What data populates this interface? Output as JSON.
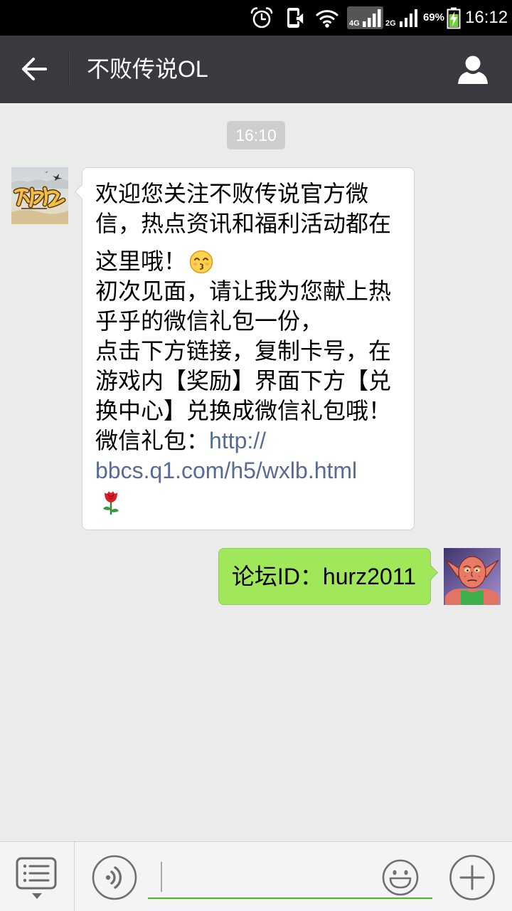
{
  "status_bar": {
    "icons": [
      "alarm-icon",
      "vibrate-icon",
      "wifi-icon",
      "signal-4g-icon",
      "signal-2g-icon",
      "battery-charging-icon"
    ],
    "network_primary": "4G",
    "network_secondary": "2G",
    "battery_level": "69%",
    "time": "16:12"
  },
  "header": {
    "back_icon": "back-arrow-icon",
    "title": "不败传说OL",
    "profile_icon": "person-icon"
  },
  "chat": {
    "timestamp": "16:10",
    "incoming": {
      "avatar": "official-account-logo-avatar",
      "greeting": "欢迎您关注不败传说官方微信，热点资讯和福利活动都在这里哦！",
      "greeting_emoji": "kissing-face-icon",
      "intro": "初次见面，请让我为您献上热乎乎的微信礼包一份，",
      "instructions": "点击下方链接，复制卡号，在游戏内【奖励】界面下方【兑换中心】兑换成微信礼包哦！",
      "gift_label": "微信礼包：",
      "gift_link": {
        "scheme": "http://",
        "address": "bbcs.q1.com/h5/wxlb.html"
      },
      "closing_emoji": "rose-icon"
    },
    "outgoing": {
      "avatar": "user-avatar",
      "text": "论坛ID：hurz2011"
    }
  },
  "input_bar": {
    "menu_icon": "menu-list-icon",
    "voice_icon": "voice-icon",
    "value": "",
    "emoji_icon": "emoji-icon",
    "plus_icon": "plus-icon"
  },
  "colors": {
    "status_bar_bg": "#000000",
    "header_bg": "#393a3f",
    "chat_bg": "#ebebeb",
    "timestamp_bg": "#cecece",
    "incoming_bubble": "#ffffff",
    "outgoing_bubble": "#a0e75a",
    "link": "#576b95",
    "input_accent": "#45c01a",
    "toolbar_bg": "#f4f4f6"
  }
}
